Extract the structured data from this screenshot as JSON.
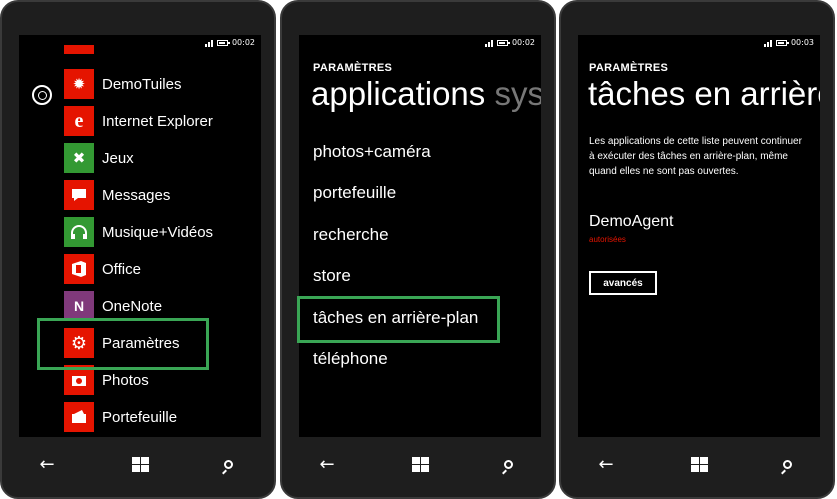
{
  "colors": {
    "accent": "#e51400",
    "highlight": "#3aa655",
    "game_tile": "#339933",
    "music_tile": "#339933",
    "office_tile": "#e51400",
    "onenote_tile": "#80397b"
  },
  "phone1": {
    "time": "00:02",
    "apps": [
      {
        "label": "DemoTuiles",
        "icon": "sun-icon"
      },
      {
        "label": "Internet Explorer",
        "icon": "ie-icon"
      },
      {
        "label": "Jeux",
        "icon": "gamepad-icon"
      },
      {
        "label": "Messages",
        "icon": "message-icon"
      },
      {
        "label": "Musique+Vidéos",
        "icon": "headphones-icon"
      },
      {
        "label": "Office",
        "icon": "office-icon"
      },
      {
        "label": "OneNote",
        "icon": "onenote-icon"
      },
      {
        "label": "Paramètres",
        "icon": "gear-icon"
      },
      {
        "label": "Photos",
        "icon": "camera-icon"
      },
      {
        "label": "Portefeuille",
        "icon": "wallet-icon"
      }
    ]
  },
  "phone2": {
    "time": "00:02",
    "header": "PARAMÈTRES",
    "pivot_title": "applications",
    "pivot_next": "sys",
    "items": [
      "photos+caméra",
      "portefeuille",
      "recherche",
      "store",
      "tâches en arrière-plan",
      "téléphone"
    ]
  },
  "phone3": {
    "time": "00:03",
    "header": "PARAMÈTRES",
    "page_title": "tâches en arrière-plan",
    "description": "Les applications de cette liste peuvent continuer à exécuter des tâches en arrière-plan, même quand elles ne sont pas ouvertes.",
    "agent_name": "DemoAgent",
    "agent_status": "autorisées",
    "advanced_button": "avancés"
  }
}
